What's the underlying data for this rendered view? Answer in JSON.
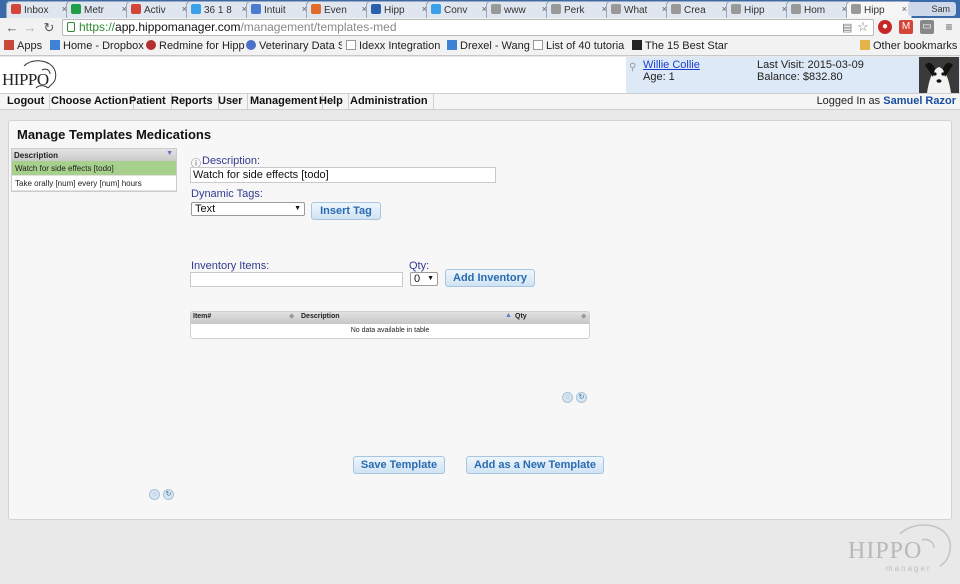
{
  "browser": {
    "tabs": [
      {
        "label": "Inbox",
        "color": "#d44638"
      },
      {
        "label": "Metr",
        "color": "#1e9e47"
      },
      {
        "label": "Activ",
        "color": "#d44638"
      },
      {
        "label": "36 1 8",
        "color": "#3aa0e8"
      },
      {
        "label": "Intuit",
        "color": "#4a7bd0"
      },
      {
        "label": "Even",
        "color": "#e26a2c"
      },
      {
        "label": "Hipp",
        "color": "#2a5fb0"
      },
      {
        "label": "Conv",
        "color": "#3aa0e8"
      },
      {
        "label": "www",
        "color": "#999999"
      },
      {
        "label": "Perk",
        "color": "#999999"
      },
      {
        "label": "What",
        "color": "#999999"
      },
      {
        "label": "Crea",
        "color": "#999999"
      },
      {
        "label": "Hipp",
        "color": "#999999"
      },
      {
        "label": "Hom",
        "color": "#999999"
      },
      {
        "label": "Hipp",
        "color": "#999999"
      }
    ],
    "profile": "Sam",
    "url": {
      "scheme": "https://",
      "host": "app.hippomanager.com",
      "path": "/management/templates-med"
    },
    "bookmarks": [
      {
        "label": "Apps",
        "icon": "apps-grid-icon"
      },
      {
        "label": "Home - Dropbox",
        "icon": "dropbox-icon"
      },
      {
        "label": "Redmine for Hipp",
        "icon": "redmine-icon"
      },
      {
        "label": "Veterinary Data S",
        "icon": "paw-icon"
      },
      {
        "label": "Idexx Integration",
        "icon": "page-icon"
      },
      {
        "label": "Drexel - Wang",
        "icon": "dropbox-icon"
      },
      {
        "label": "List of 40 tutorial",
        "icon": "page-icon"
      },
      {
        "label": "The 15 Best Start",
        "icon": "page-icon"
      }
    ],
    "other_bookmarks": "Other bookmarks"
  },
  "app": {
    "logo_text": "HIPPO",
    "patient": {
      "name": "Willie Collie",
      "age": "Age: 1",
      "last_visit": "Last Visit: 2015-03-09",
      "balance": "Balance: $832.80"
    },
    "menu": [
      "Logout",
      "Choose Action",
      "Patient",
      "Reports",
      "User",
      "Management",
      "Help",
      "Administration"
    ],
    "logged_in_prefix": "Logged In as",
    "logged_in_user": "Samuel Razor"
  },
  "page": {
    "title": "Manage Templates Medications",
    "list": {
      "header": "Description",
      "rows": [
        "Watch for side effects [todo]",
        "Take orally [num] every [num] hours"
      ]
    },
    "form": {
      "description_label": "Description:",
      "description_value": "Watch for side effects [todo]",
      "dynamic_tags_label": "Dynamic Tags:",
      "dynamic_tags_value": "Text",
      "insert_tag": "Insert Tag",
      "inventory_label": "Inventory Items:",
      "qty_label": "Qty:",
      "qty_value": "0",
      "add_inventory": "Add Inventory"
    },
    "inventory_table": {
      "columns": [
        "Item#",
        "Description",
        "Qty"
      ],
      "empty_text": "No data available in table"
    },
    "save_template": "Save Template",
    "add_new_template": "Add as a New Template"
  },
  "watermark": {
    "title": "HIPPO",
    "subtitle": "manager"
  }
}
